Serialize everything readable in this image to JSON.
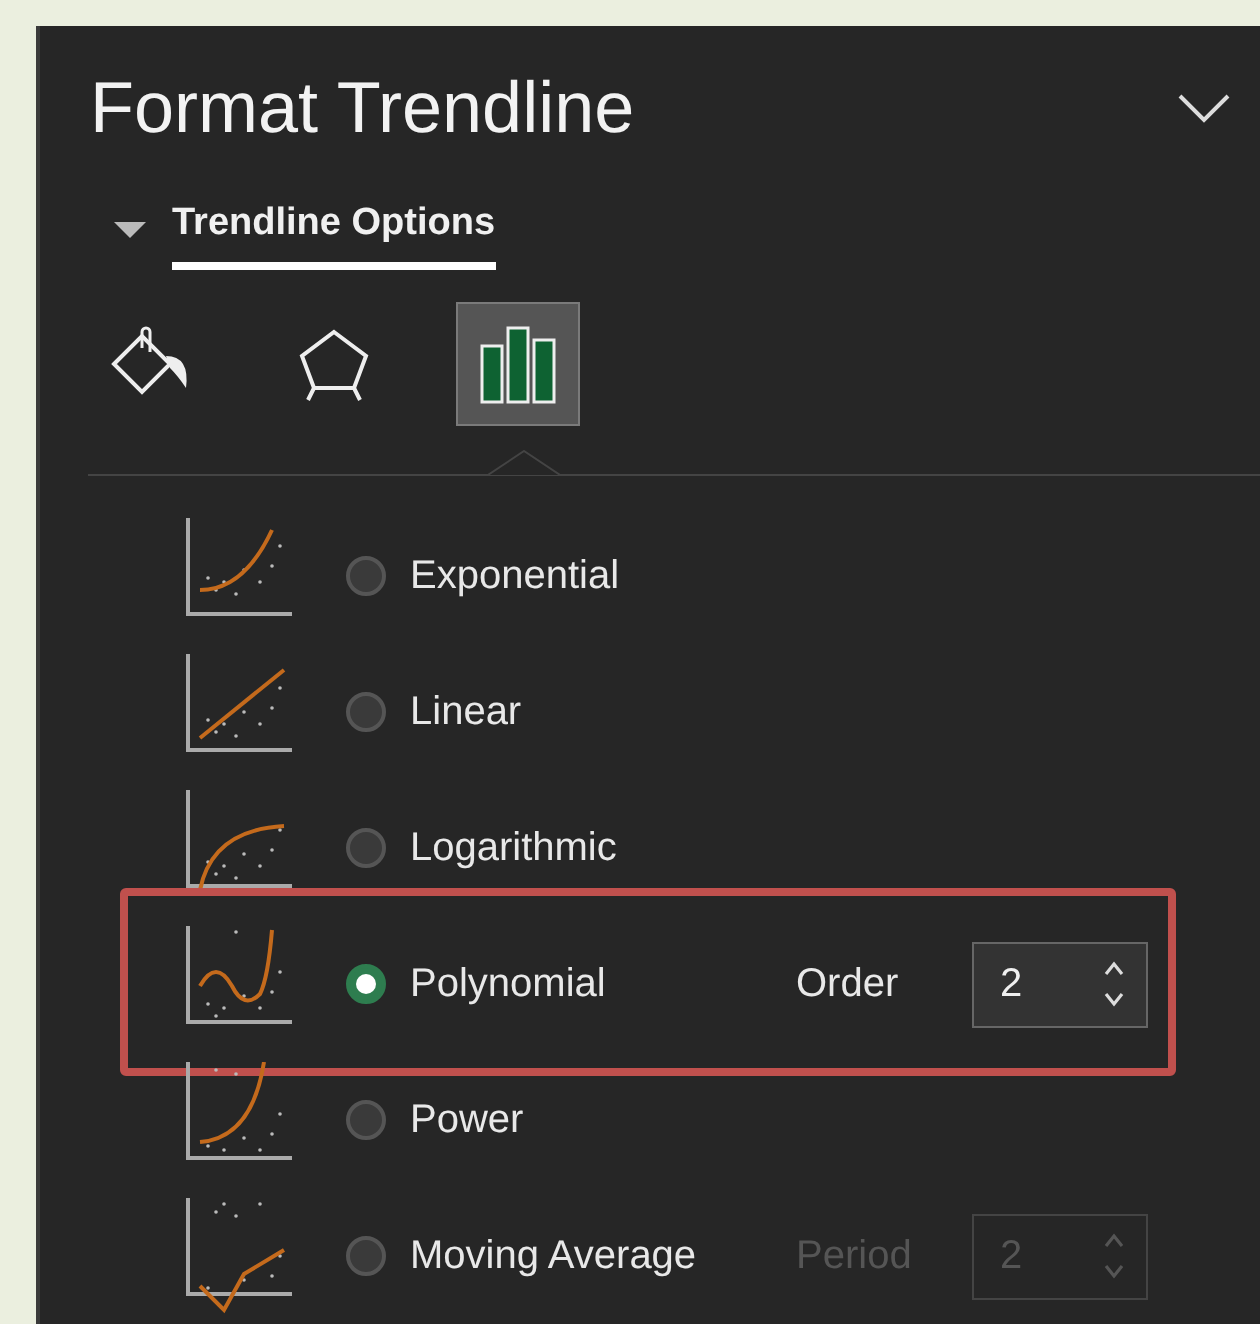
{
  "panel": {
    "title": "Format Trendline",
    "section": {
      "label": "Trendline Options",
      "expanded": true
    },
    "icon_tabs": [
      {
        "selected": false
      },
      {
        "selected": false
      },
      {
        "selected": true
      }
    ],
    "options": [
      {
        "label": "Exponential",
        "selected": false,
        "highlighted": false
      },
      {
        "label": "Linear",
        "selected": false,
        "highlighted": false
      },
      {
        "label": "Logarithmic",
        "selected": false,
        "highlighted": false
      },
      {
        "label": "Polynomial",
        "selected": true,
        "highlighted": true,
        "parameter": {
          "label": "Order",
          "value": "2",
          "disabled": false
        }
      },
      {
        "label": "Power",
        "selected": false,
        "highlighted": false
      },
      {
        "label": "Moving Average",
        "selected": false,
        "highlighted": false,
        "parameter": {
          "label": "Period",
          "value": "2",
          "disabled": true
        }
      }
    ]
  }
}
